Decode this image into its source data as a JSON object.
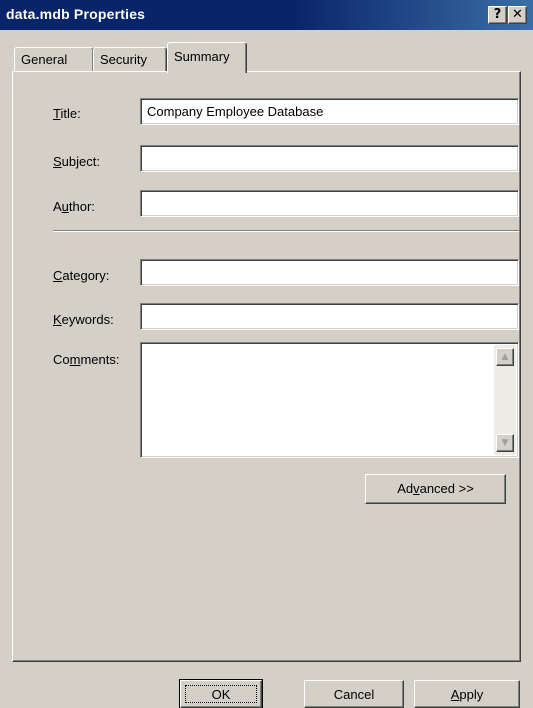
{
  "window": {
    "title": "data.mdb Properties",
    "help_label": "?",
    "close_label": "✕"
  },
  "tabs": [
    {
      "label": "General",
      "active": false
    },
    {
      "label": "Security",
      "active": false
    },
    {
      "label": "Summary",
      "active": true
    }
  ],
  "fields": {
    "title": {
      "label_pre": "",
      "label_key": "T",
      "label_post": "itle:",
      "value": "Company Employee Database"
    },
    "subject": {
      "label_pre": "",
      "label_key": "S",
      "label_post": "ubject:",
      "value": ""
    },
    "author": {
      "label_pre": "A",
      "label_key": "u",
      "label_post": "thor:",
      "value": ""
    },
    "category": {
      "label_pre": "",
      "label_key": "C",
      "label_post": "ategory:",
      "value": ""
    },
    "keywords": {
      "label_pre": "",
      "label_key": "K",
      "label_post": "eywords:",
      "value": ""
    },
    "comments": {
      "label_pre": "Co",
      "label_key": "m",
      "label_post": "ments:",
      "value": ""
    }
  },
  "scrollbar": {
    "up_icon": "▲",
    "down_icon": "▼"
  },
  "buttons": {
    "advanced": {
      "pre": "Ad",
      "key": "v",
      "post": "anced >>"
    },
    "ok": "OK",
    "cancel": "Cancel",
    "apply": {
      "pre": "",
      "key": "A",
      "post": "pply"
    }
  }
}
